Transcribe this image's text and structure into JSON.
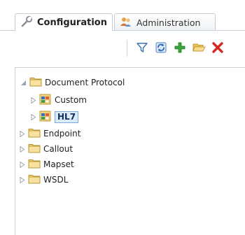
{
  "tabs": [
    {
      "label": "Configuration",
      "icon": "wrench-icon",
      "active": true
    },
    {
      "label": "Administration",
      "icon": "users-icon",
      "active": false
    }
  ],
  "toolbar": {
    "buttons": [
      {
        "name": "filter",
        "icon": "filter-icon"
      },
      {
        "name": "refresh",
        "icon": "refresh-icon"
      },
      {
        "name": "add",
        "icon": "plus-icon"
      },
      {
        "name": "open",
        "icon": "open-folder-icon"
      },
      {
        "name": "delete",
        "icon": "delete-icon"
      }
    ]
  },
  "tree": {
    "nodes": [
      {
        "label": "Document Protocol",
        "expanded": true,
        "icon": "folder-icon"
      },
      {
        "label": "Custom",
        "expanded": false,
        "icon": "protocol-icon"
      },
      {
        "label": "HL7",
        "expanded": false,
        "icon": "protocol-icon",
        "selected": true
      },
      {
        "label": "Endpoint",
        "expanded": false,
        "icon": "folder-icon"
      },
      {
        "label": "Callout",
        "expanded": false,
        "icon": "folder-icon"
      },
      {
        "label": "Mapset",
        "expanded": false,
        "icon": "folder-icon"
      },
      {
        "label": "WSDL",
        "expanded": false,
        "icon": "folder-icon"
      }
    ]
  },
  "colors": {
    "folder": "#f2d27a",
    "accent_border": "#c9d1da",
    "filter_blue": "#3b6fb6",
    "add_green": "#2f9b2f",
    "delete_red": "#d12b1f",
    "selection": "#dce9f7"
  }
}
